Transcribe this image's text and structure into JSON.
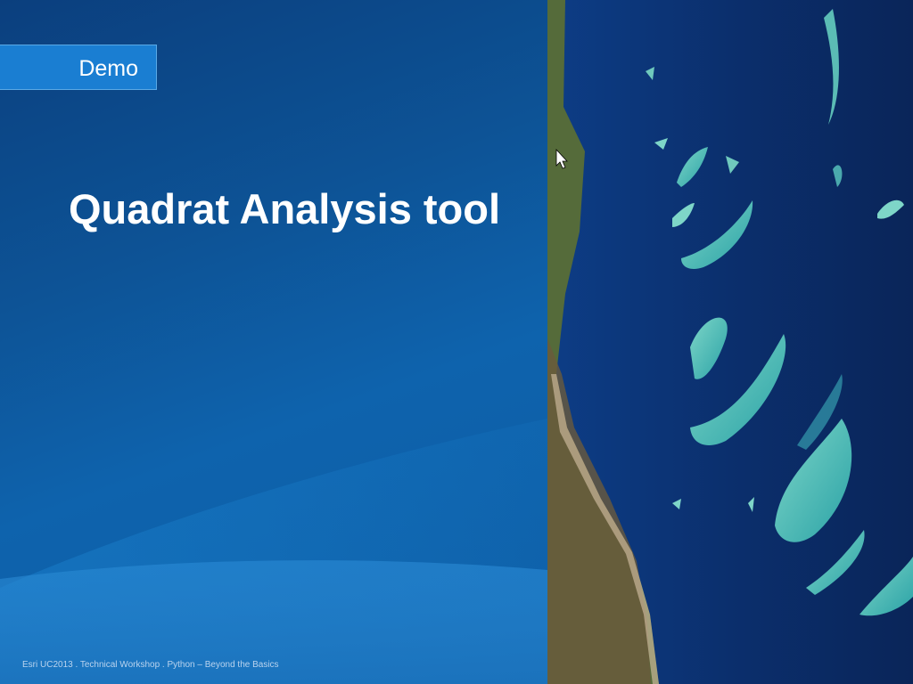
{
  "slide": {
    "badge_label": "Demo",
    "title": "Quadrat Analysis tool",
    "footer": "Esri UC2013 . Technical Workshop . Python – Beyond the Basics"
  },
  "image": {
    "alt": "satellite-reef-image"
  },
  "colors": {
    "panel": "#0e5aa3",
    "badge": "#1a7ed2",
    "text": "#ffffff"
  }
}
